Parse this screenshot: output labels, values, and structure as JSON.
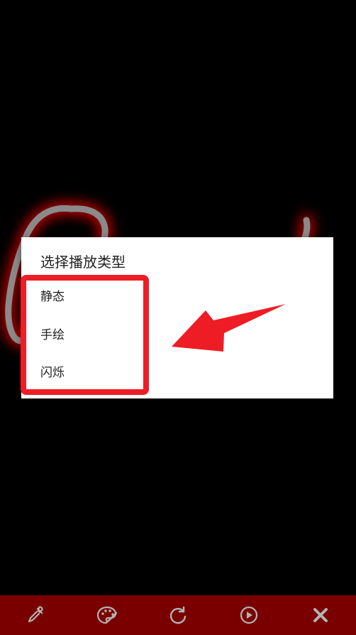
{
  "dialog": {
    "title": "选择播放类型",
    "options": [
      {
        "label": "静态"
      },
      {
        "label": "手绘"
      },
      {
        "label": "闪烁"
      }
    ]
  },
  "colors": {
    "background": "#000000",
    "dialog_background": "#ffffff",
    "annotation_red": "#ee1c25",
    "stroke_gray": "#8a8a8a",
    "stroke_glow": "#ff0000",
    "toolbar_background": "#7a0000",
    "toolbar_icon": "#b3b3b3"
  },
  "toolbar": {
    "icons": [
      "eyedropper-icon",
      "palette-icon",
      "refresh-icon",
      "play-icon",
      "close-icon"
    ]
  }
}
